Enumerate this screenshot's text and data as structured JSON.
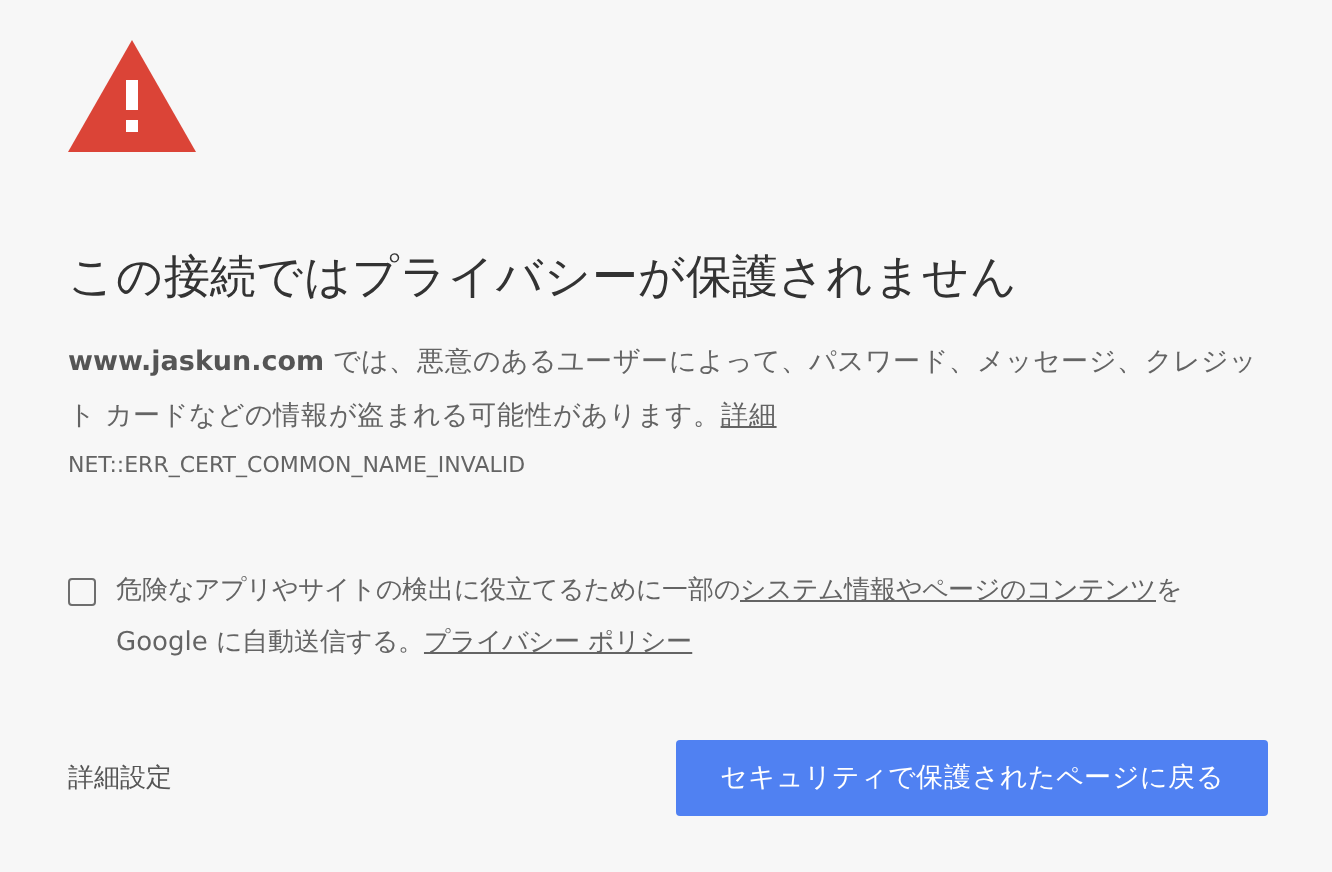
{
  "title": "この接続ではプライバシーが保護されません",
  "description": {
    "parts": [
      {
        "kind": "text",
        "text": "**www.jaskun.com** では、悪意のあるユーザーによって、パスワード、メッセージ、クレジット カードなどの情報が盗まれる可能性があります。"
      },
      {
        "kind": "link",
        "text": "詳細"
      }
    ]
  },
  "error_code": "NET::ERR_CERT_COMMON_NAME_INVALID",
  "report_checkbox": {
    "checked": false,
    "parts": [
      {
        "kind": "text",
        "text": "危険なアプリやサイトの検出に役立てるために一部の"
      },
      {
        "kind": "link",
        "text": "システム情報やページのコンテンツ"
      },
      {
        "kind": "text",
        "text": "を Google に自動送信する。"
      },
      {
        "kind": "link",
        "text": "プライバシー ポリシー"
      }
    ]
  },
  "advanced_link": "詳細設定",
  "back_button": "セキュリティで保護されたページに戻る"
}
